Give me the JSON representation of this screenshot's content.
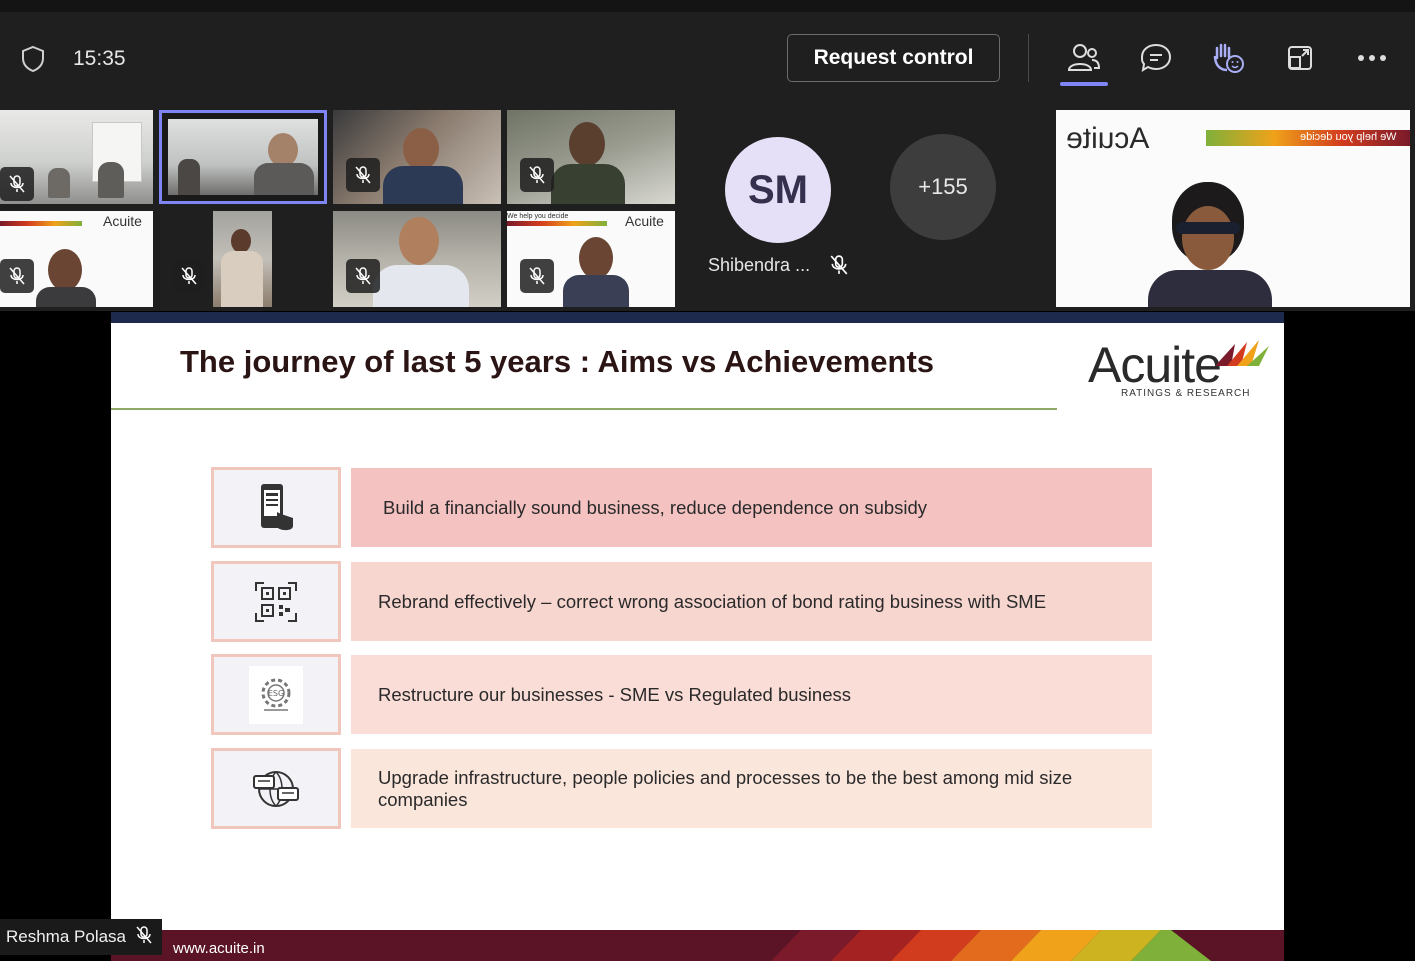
{
  "toolbar": {
    "time": "15:35",
    "request_control_label": "Request control",
    "icons": [
      "shield-icon",
      "people-icon",
      "chat-icon",
      "raise-hand-icon",
      "share-tray-icon",
      "more-icon"
    ]
  },
  "participants": {
    "named_tile": {
      "initials": "SM",
      "name": "Shibendra ..."
    },
    "overflow_count": "+155",
    "brand_tile": {
      "tagline": "We help you decide",
      "logo_text": "Acuite"
    },
    "small_logo_text": "Acuite",
    "small_tagline": "We help you decide"
  },
  "slide": {
    "title": "The journey of last 5 years : Aims vs Achievements",
    "logo": {
      "word": "Acuite",
      "sub": "RATINGS & RESEARCH"
    },
    "rows": [
      {
        "text": "Build a financially sound business, reduce dependence on subsidy",
        "icon": "mobile-touch-icon",
        "color": "#f5c2c2"
      },
      {
        "text": "Rebrand effectively – correct wrong association of bond rating business with SME",
        "icon": "qr-code-icon",
        "color": "#f8d6d0"
      },
      {
        "text": "Restructure our businesses - SME vs Regulated business",
        "icon": "esg-gear-icon",
        "color": "#f9ddd6"
      },
      {
        "text": "Upgrade infrastructure, people policies and processes to be the best among mid size companies",
        "icon": "chat-globe-icon",
        "color": "#fbe6dc"
      }
    ],
    "footer_url": "www.acuite.in"
  },
  "speaker": {
    "name": "Reshma Polasa"
  },
  "colors": {
    "accent": "#7f85f5",
    "footer": "#5a1426",
    "title_line": "#8ea86a"
  }
}
